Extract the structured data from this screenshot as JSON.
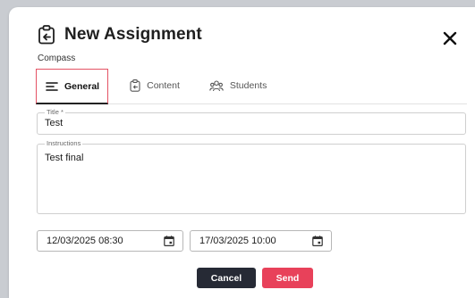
{
  "dialog": {
    "title": "New Assignment",
    "subtitle": "Compass",
    "close_icon": "close-icon",
    "title_icon": "clipboard-return-icon"
  },
  "tabs": [
    {
      "label": "General",
      "icon": "lines-icon",
      "active": true
    },
    {
      "label": "Content",
      "icon": "clipboard-icon",
      "active": false
    },
    {
      "label": "Students",
      "icon": "group-icon",
      "active": false
    }
  ],
  "form": {
    "title_label": "Title *",
    "title_value": "Test",
    "instructions_label": "Instructions",
    "instructions_value": "Test final",
    "start_date": "12/03/2025 08:30",
    "end_date": "17/03/2025 10:00"
  },
  "actions": {
    "cancel_label": "Cancel",
    "send_label": "Send"
  },
  "colors": {
    "accent": "#e8415a",
    "dark_button": "#262a35",
    "backdrop": "#c9ccd1"
  }
}
